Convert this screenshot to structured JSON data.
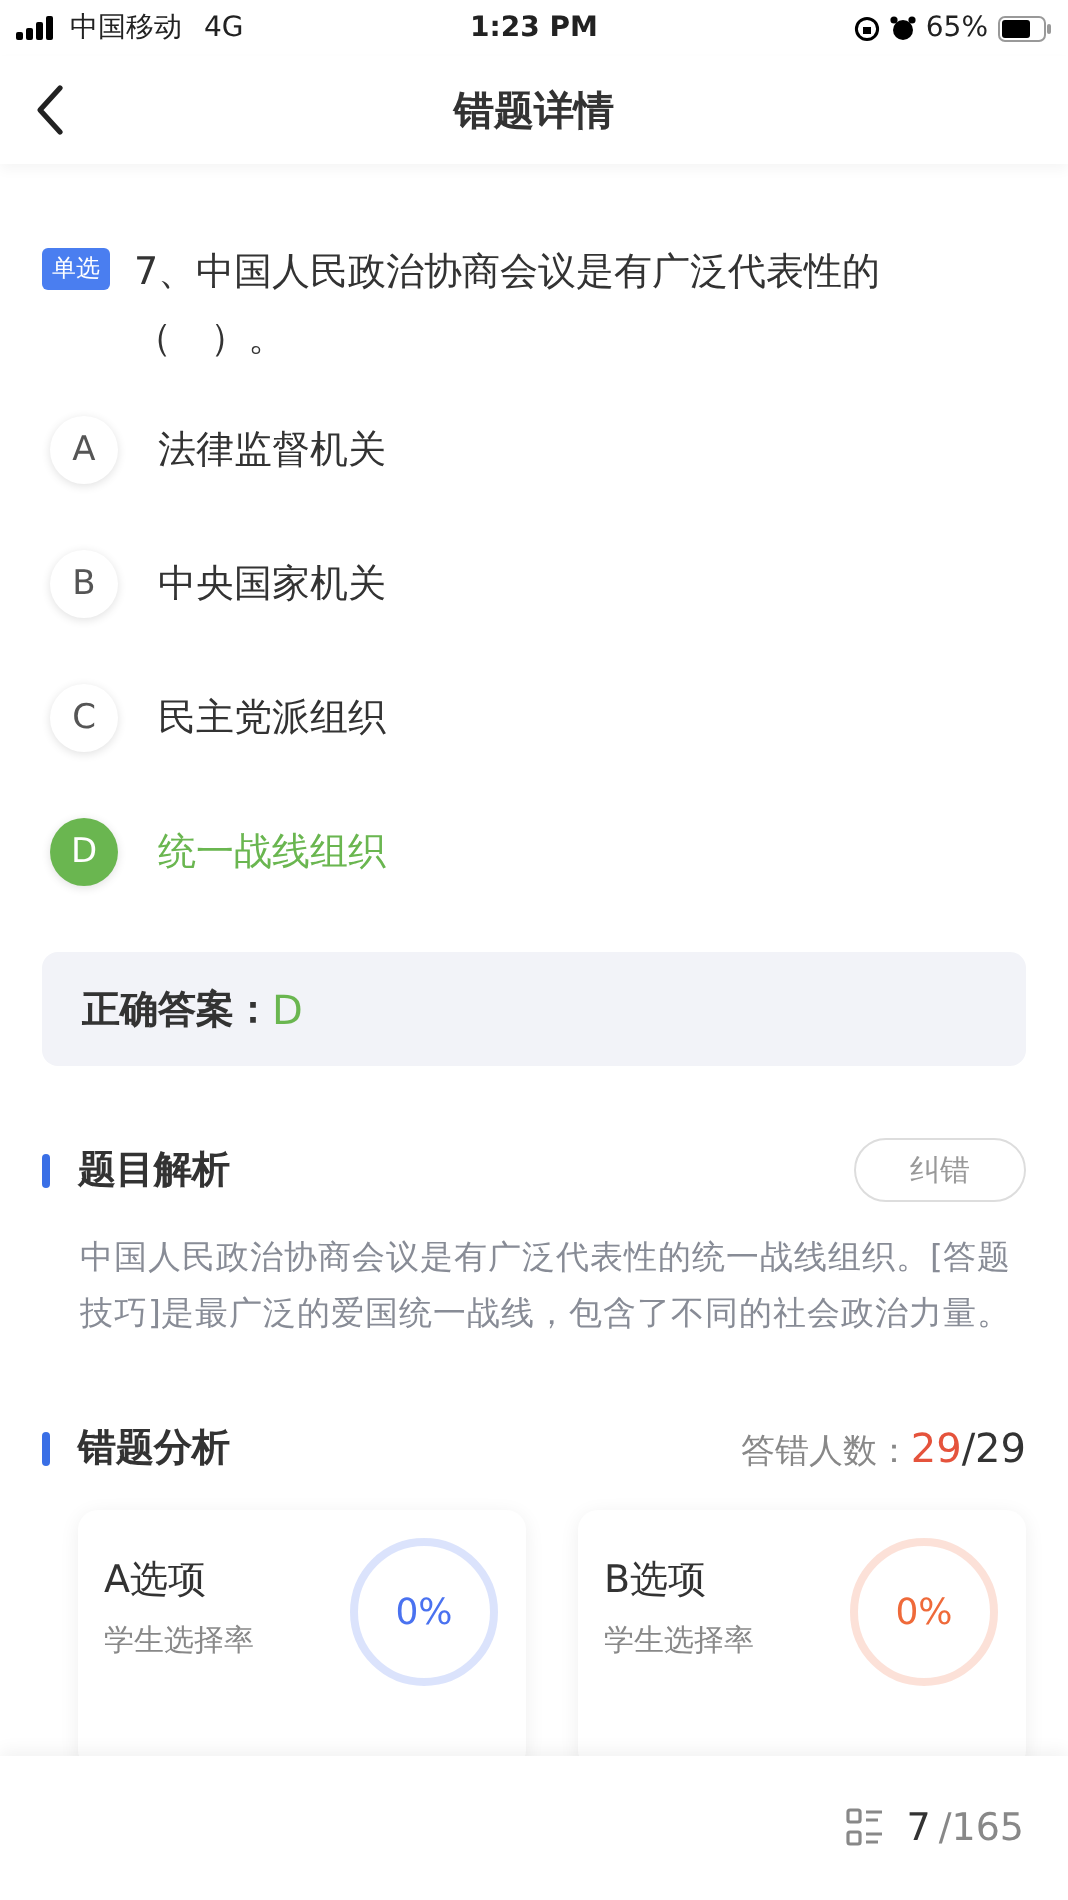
{
  "status_bar": {
    "carrier": "中国移动",
    "network": "4G",
    "time": "1:23 PM",
    "battery": "65%"
  },
  "nav": {
    "title": "错题详情"
  },
  "question": {
    "type_tag": "单选",
    "text": "7、中国人民政治协商会议是有广泛代表性的（　）。"
  },
  "options": [
    {
      "letter": "A",
      "text": "法律监督机关",
      "selected": false
    },
    {
      "letter": "B",
      "text": "中央国家机关",
      "selected": false
    },
    {
      "letter": "C",
      "text": "民主党派组织",
      "selected": false
    },
    {
      "letter": "D",
      "text": "统一战线组织",
      "selected": true
    }
  ],
  "correct_answer": {
    "label": "正确答案：",
    "value": "D"
  },
  "analysis": {
    "title": "题目解析",
    "report_button": "纠错",
    "text": "中国人民政治协商会议是有广泛代表性的统一战线组织。[答题技巧]是最广泛的爱国统一战线，包含了不同的社会政治力量。"
  },
  "error_analysis": {
    "title": "错题分析",
    "count_label": "答错人数：",
    "wrong": "29",
    "total": "/29",
    "cards": [
      {
        "title": "A选项",
        "subtitle": "学生选择率",
        "percent": "0%",
        "color": "#4a72f0"
      },
      {
        "title": "B选项",
        "subtitle": "学生选择率",
        "percent": "0%",
        "color": "#ef6a3a"
      }
    ]
  },
  "footer": {
    "current": "7",
    "total": "/165"
  }
}
